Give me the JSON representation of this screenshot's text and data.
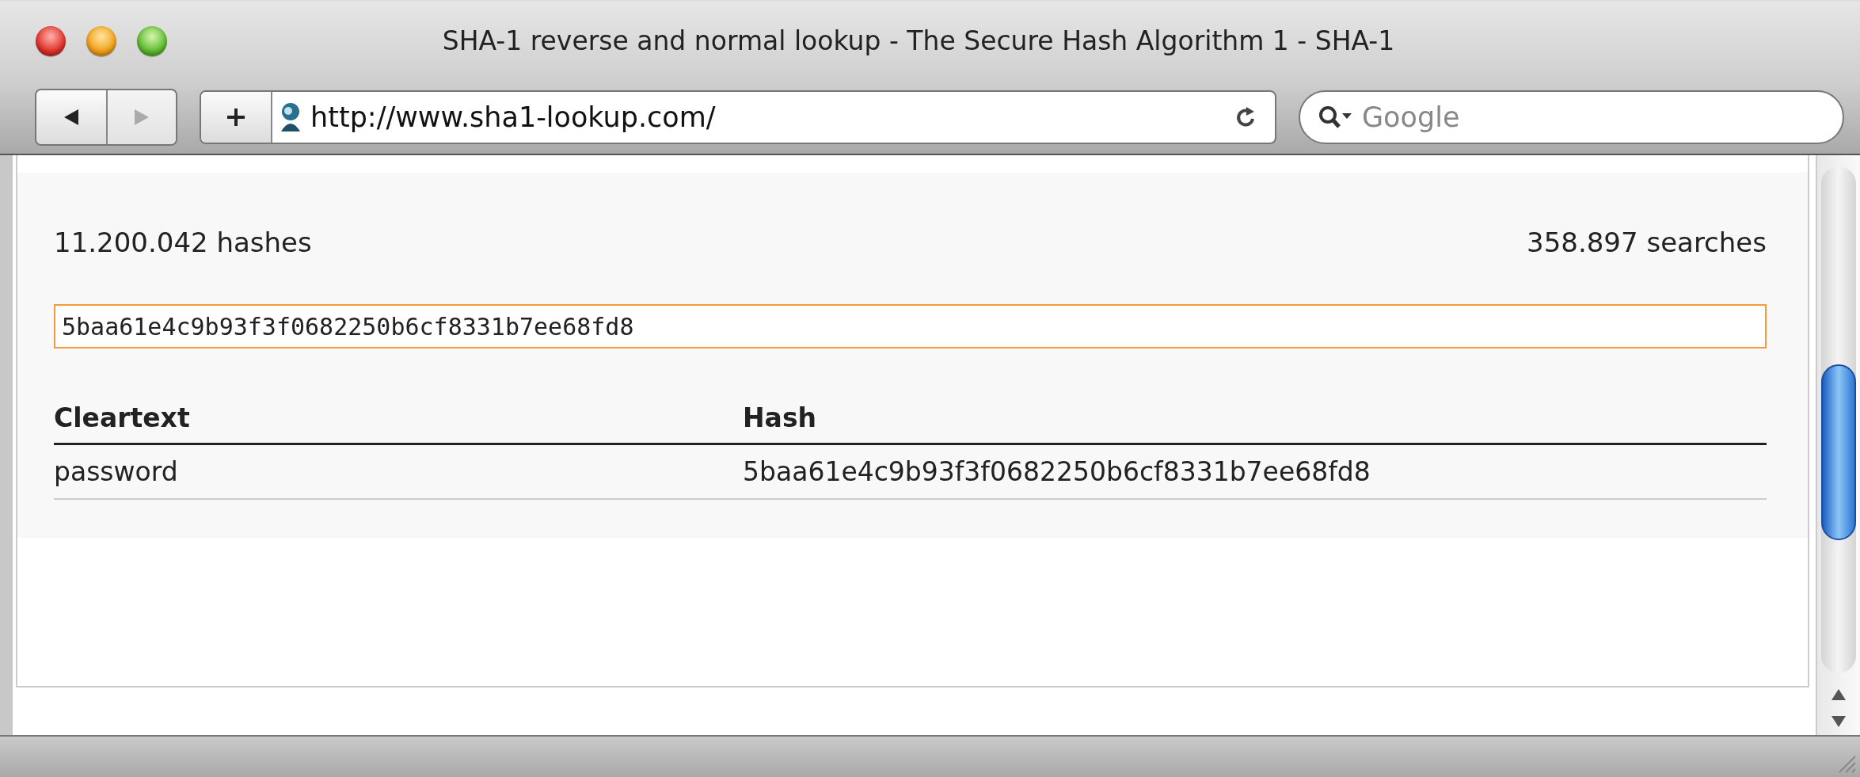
{
  "window": {
    "title": "SHA-1 reverse and normal lookup - The Secure Hash Algorithm 1 - SHA-1"
  },
  "toolbar": {
    "nav_buttons": [
      {
        "kind": "back",
        "disabled": false
      },
      {
        "kind": "forward",
        "disabled": true
      }
    ],
    "url": "http://www.sha1-lookup.com/",
    "search": {
      "placeholder": "Google"
    }
  },
  "page": {
    "hash_count": "11.200.042 hashes",
    "search_count": "358.897 searches",
    "lookup_field": {
      "value": "5baa61e4c9b93f3f0682250b6cf8331b7ee68fd8"
    },
    "table": {
      "columns": [
        "Cleartext",
        "Hash"
      ],
      "rows": [
        [
          "password",
          "5baa61e4c9b93f3f0682250b6cf8331b7ee68fd8"
        ]
      ]
    }
  }
}
